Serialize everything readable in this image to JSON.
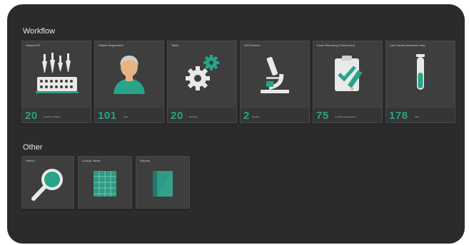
{
  "sections": {
    "workflow": {
      "title": "Workflow",
      "cards": [
        {
          "title": "Sample KIT",
          "count": "20",
          "count_label": "samples in Plates",
          "icon": "pipette-rack-icon"
        },
        {
          "title": "Patient Registration",
          "count": "101",
          "count_label": "total",
          "icon": "patient-icon"
        },
        {
          "title": "Tasks",
          "count": "20",
          "count_label": "Running",
          "icon": "gears-icon"
        },
        {
          "title": "SAS Review",
          "count": "2",
          "count_label": "pending",
          "icon": "microscope-icon"
        },
        {
          "title": "Exam Reporting (Clinical info)",
          "count": "75",
          "count_label": "to review and approve",
          "icon": "clipboard-edit-icon"
        },
        {
          "title": "Lab Checks (specimen info)",
          "count": "178",
          "count_label": "total",
          "icon": "test-tube-icon"
        }
      ]
    },
    "other": {
      "title": "Other",
      "cards": [
        {
          "title": "Search",
          "icon": "magnifier-icon"
        },
        {
          "title": "Lookup Tables",
          "icon": "grid-map-icon"
        },
        {
          "title": "Reports",
          "icon": "report-icon"
        }
      ]
    }
  },
  "colors": {
    "background": "#2b2b2b",
    "card": "#3e3e3e",
    "accent": "#27a489"
  }
}
